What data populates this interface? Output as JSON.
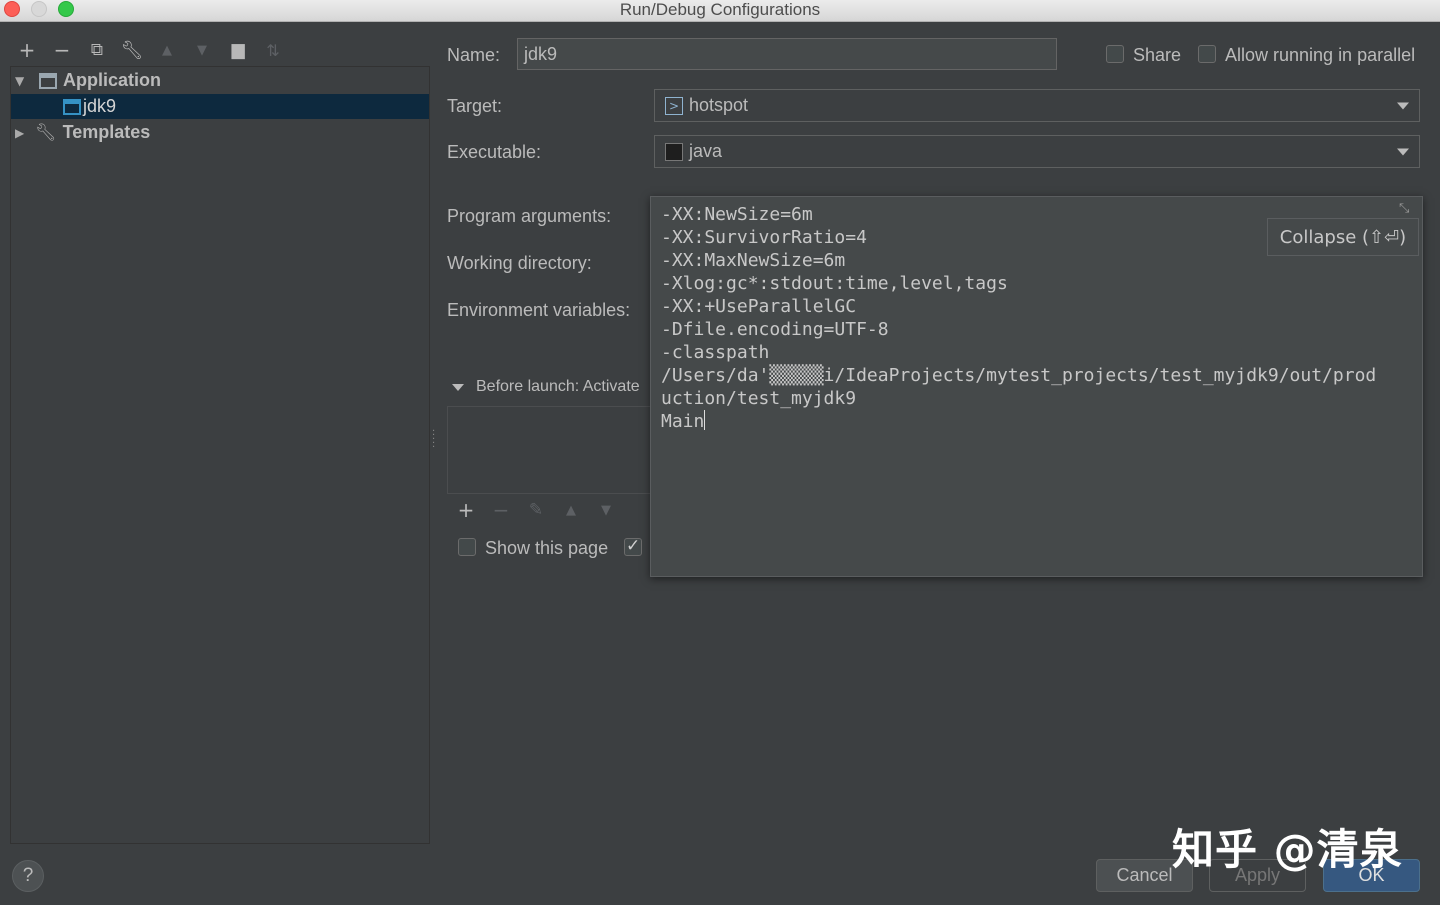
{
  "window": {
    "title": "Run/Debug Configurations"
  },
  "toolbar": {
    "icons": [
      "add-icon",
      "remove-icon",
      "copy-icon",
      "wrench-icon",
      "move-up-icon",
      "move-down-icon",
      "folder-icon",
      "sort-icon"
    ]
  },
  "tree": {
    "group_label": "Application",
    "item_label": "jdk9",
    "templates_label": "Templates"
  },
  "form": {
    "name_label": "Name:",
    "name_value": "jdk9",
    "share_label": "Share",
    "share_checked": false,
    "parallel_label": "Allow running in parallel",
    "parallel_checked": false,
    "target_label": "Target:",
    "target_value": "hotspot",
    "executable_label": "Executable:",
    "executable_value": "java",
    "program_args_label": "Program arguments:",
    "working_dir_label": "Working directory:",
    "env_vars_label": "Environment variables:"
  },
  "before_launch": {
    "header": "Before launch: Activate",
    "show_page_label": "Show this page",
    "show_page_checked": false,
    "activate_checked": true
  },
  "expanded_args": {
    "lines": [
      "-XX:NewSize=6m",
      "-XX:SurvivorRatio=4",
      "-XX:MaxNewSize=6m",
      "-Xlog:gc*:stdout:time,level,tags",
      "-XX:+UseParallelGC",
      "-Dfile.encoding=UTF-8",
      "-classpath",
      "/Users/da'▒▒▒▒▒i/IdeaProjects/mytest_projects/test_myjdk9/out/prod",
      "uction/test_myjdk9",
      "Main"
    ],
    "collapse_label": "Collapse (⇧⏎)"
  },
  "buttons": {
    "help": "?",
    "cancel": "Cancel",
    "apply": "Apply",
    "ok": "OK"
  },
  "watermark": "知乎 @清泉",
  "colors": {
    "background": "#3c3f41",
    "selection": "#0d293e",
    "primary_button": "#365880"
  }
}
